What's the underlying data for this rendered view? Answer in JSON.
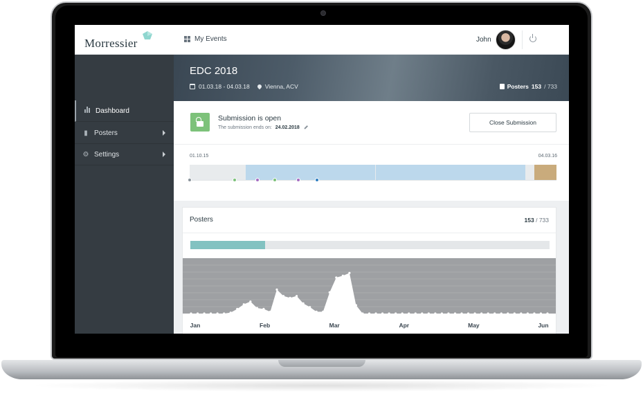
{
  "topbar": {
    "logo_text": "Morressier",
    "nav_label": "My Events",
    "user_name": "John"
  },
  "sidebar": {
    "items": [
      {
        "label": "Dashboard",
        "icon": "bar-chart-icon",
        "active": true
      },
      {
        "label": "Posters",
        "icon": "document-icon",
        "has_submenu": true
      },
      {
        "label": "Settings",
        "icon": "gear-icon",
        "has_submenu": true
      }
    ]
  },
  "event": {
    "title": "EDC 2018",
    "dates": "01.03.18 - 04.03.18",
    "location": "Vienna, ACV",
    "posters_label": "Posters",
    "posters_count": "153",
    "posters_total": "/ 733"
  },
  "submission": {
    "title": "Submission is open",
    "ends_label": "The submission ends on:",
    "ends_date": "24.02.2018",
    "close_button": "Close Submission",
    "timeline_start": "01.10.15",
    "timeline_end": "04.03.16",
    "timeline_segments": [
      {
        "from": 0.152,
        "to": 0.506,
        "color": "#bcd8ec"
      },
      {
        "from": 0.508,
        "to": 0.915,
        "color": "#bcd8ec"
      },
      {
        "from": 0.94,
        "to": 1.0,
        "color": "#c9ab7c"
      }
    ],
    "timeline_markers": [
      {
        "at": 0.0,
        "color": "#8a939b"
      },
      {
        "at": 0.122,
        "color": "#7dc27a"
      },
      {
        "at": 0.185,
        "color": "#a56cc1"
      },
      {
        "at": 0.232,
        "color": "#7dc27a"
      },
      {
        "at": 0.297,
        "color": "#a56cc1"
      },
      {
        "at": 0.347,
        "color": "#2f7ec1"
      }
    ]
  },
  "posters": {
    "title": "Posters",
    "count": "153",
    "total": "/ 733",
    "progress": 0.209
  },
  "chart_data": {
    "type": "area",
    "x_labels": [
      "Jan",
      "Feb",
      "Mar",
      "Apr",
      "May",
      "Jun"
    ],
    "values": [
      0,
      0,
      0,
      0,
      0,
      0,
      1,
      5,
      10,
      13,
      6,
      5,
      2,
      26,
      19,
      17,
      19,
      11,
      7,
      2,
      2,
      23,
      39,
      41,
      44,
      9,
      0,
      0,
      0,
      0,
      0,
      0,
      0,
      0,
      0,
      0,
      0,
      0,
      0,
      0,
      0,
      0,
      0,
      0,
      0,
      0,
      0,
      0,
      0,
      0,
      0,
      0,
      0,
      0,
      0
    ],
    "ylim": [
      0,
      60
    ],
    "grid": true,
    "colors": {
      "background": "#9ea0a3",
      "fill": "#ffffff"
    }
  }
}
